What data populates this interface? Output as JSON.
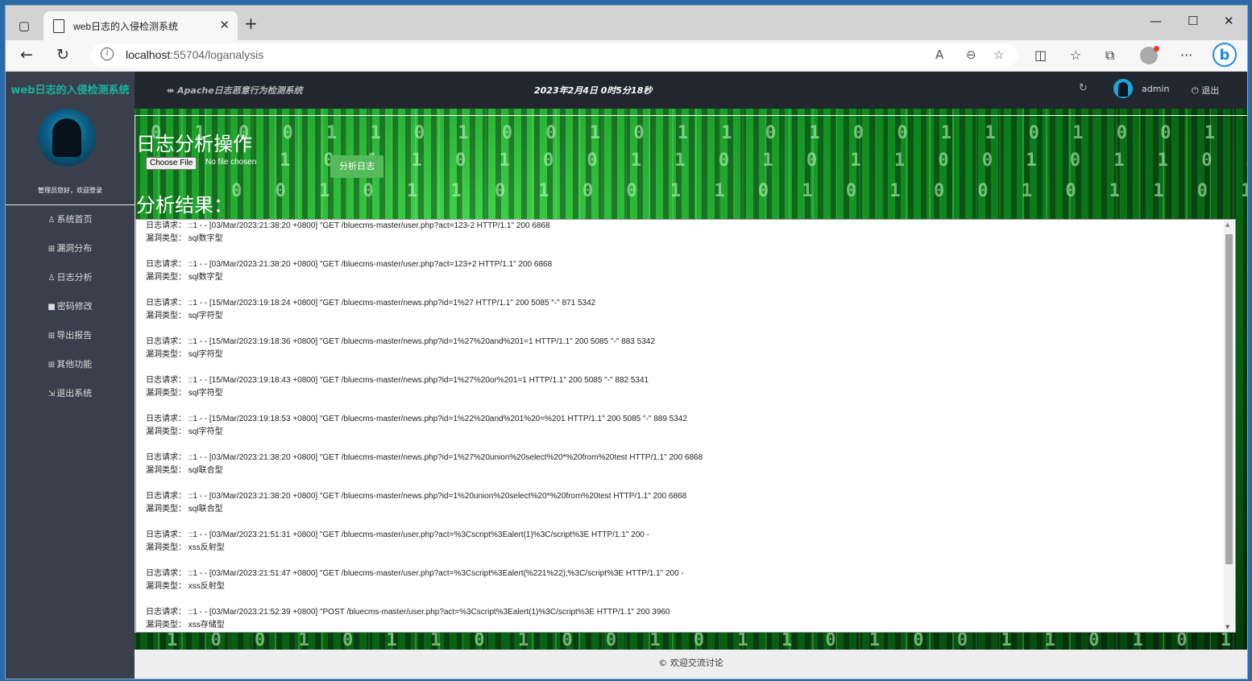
{
  "browser": {
    "tab_title": "web日志的入侵检测系统",
    "url_host": "localhost",
    "url_rest": ":55704/loganalysis"
  },
  "sidebar": {
    "title": "web日志的入侵检测系统",
    "welcome": "管理员您好，欢迎登录",
    "items": [
      {
        "icon": "user-icon",
        "label": "系统首页"
      },
      {
        "icon": "bug-icon",
        "label": "漏洞分布"
      },
      {
        "icon": "person-icon",
        "label": "日志分析"
      },
      {
        "icon": "chat-icon",
        "label": "密码修改"
      },
      {
        "icon": "export-icon",
        "label": "导出报告"
      },
      {
        "icon": "grid-icon",
        "label": "其他功能"
      },
      {
        "icon": "logout-icon",
        "label": "退出系统"
      }
    ]
  },
  "header": {
    "subtitle": "Apache日志恶意行为检测系统",
    "datetime": "2023年2月4日 0时5分18秒",
    "username": "admin",
    "logout": "退出"
  },
  "page": {
    "section_title": "日志分析操作",
    "choose_file": "Choose File",
    "no_file": "No file chosen",
    "analyze_button": "分析日志",
    "result_title": "分析结果："
  },
  "results": [
    {
      "req_label": "日志请求：",
      "req": "::1 - - [03/Mar/2023:21:38:20 +0800] \"GET /bluecms-master/user.php?act=123-2 HTTP/1.1\" 200 6868",
      "type_label": "漏洞类型：",
      "type": "sql数字型"
    },
    {
      "req_label": "日志请求：",
      "req": "::1 - - [03/Mar/2023:21:38:20 +0800] \"GET /bluecms-master/user.php?act=123+2 HTTP/1.1\" 200 6868",
      "type_label": "漏洞类型：",
      "type": "sql数字型"
    },
    {
      "req_label": "日志请求：",
      "req": "::1 - - [15/Mar/2023:19:18:24 +0800] \"GET /bluecms-master/news.php?id=1%27 HTTP/1.1\" 200 5085 \"-\" 871 5342",
      "type_label": "漏洞类型：",
      "type": "sql字符型"
    },
    {
      "req_label": "日志请求：",
      "req": "::1 - - [15/Mar/2023:19:18:36 +0800] \"GET /bluecms-master/news.php?id=1%27%20and%201=1 HTTP/1.1\" 200 5085 \"-\" 883 5342",
      "type_label": "漏洞类型：",
      "type": "sql字符型"
    },
    {
      "req_label": "日志请求：",
      "req": "::1 - - [15/Mar/2023:19:18:43 +0800] \"GET /bluecms-master/news.php?id=1%27%20or%201=1 HTTP/1.1\" 200 5085 \"-\" 882 5341",
      "type_label": "漏洞类型：",
      "type": "sql字符型"
    },
    {
      "req_label": "日志请求：",
      "req": "::1 - - [15/Mar/2023:19:18:53 +0800] \"GET /bluecms-master/news.php?id=1%22%20and%201%20=%201 HTTP/1.1\" 200 5085 \"-\" 889 5342",
      "type_label": "漏洞类型：",
      "type": "sql字符型"
    },
    {
      "req_label": "日志请求：",
      "req": "::1 - - [03/Mar/2023:21:38:20 +0800] \"GET /bluecms-master/news.php?id=1%27%20union%20select%20*%20from%20test HTTP/1.1\" 200 6868",
      "type_label": "漏洞类型：",
      "type": "sql联合型"
    },
    {
      "req_label": "日志请求：",
      "req": "::1 - - [03/Mar/2023:21:38:20 +0800] \"GET /bluecms-master/news.php?id=1%20union%20select%20*%20from%20test HTTP/1.1\" 200 6868",
      "type_label": "漏洞类型：",
      "type": "sql联合型"
    },
    {
      "req_label": "日志请求：",
      "req": "::1 - - [03/Mar/2023:21:51:31 +0800] \"GET /bluecms-master/user.php?act=%3Cscript%3Ealert(1)%3C/script%3E HTTP/1.1\" 200 -",
      "type_label": "漏洞类型：",
      "type": "xss反射型"
    },
    {
      "req_label": "日志请求：",
      "req": "::1 - - [03/Mar/2023:21:51:47 +0800] \"GET /bluecms-master/user.php?act=%3Cscript%3Ealert(%221%22);%3C/script%3E HTTP/1.1\" 200 -",
      "type_label": "漏洞类型：",
      "type": "xss反射型"
    },
    {
      "req_label": "日志请求：",
      "req": "::1 - - [03/Mar/2023:21:52:39 +0800] \"POST /bluecms-master/user.php?act=%3Cscript%3Ealert(1)%3C/script%3E HTTP/1.1\" 200 3960",
      "type_label": "漏洞类型：",
      "type": "xss存储型"
    }
  ],
  "footer": "© 欢迎交流讨论"
}
